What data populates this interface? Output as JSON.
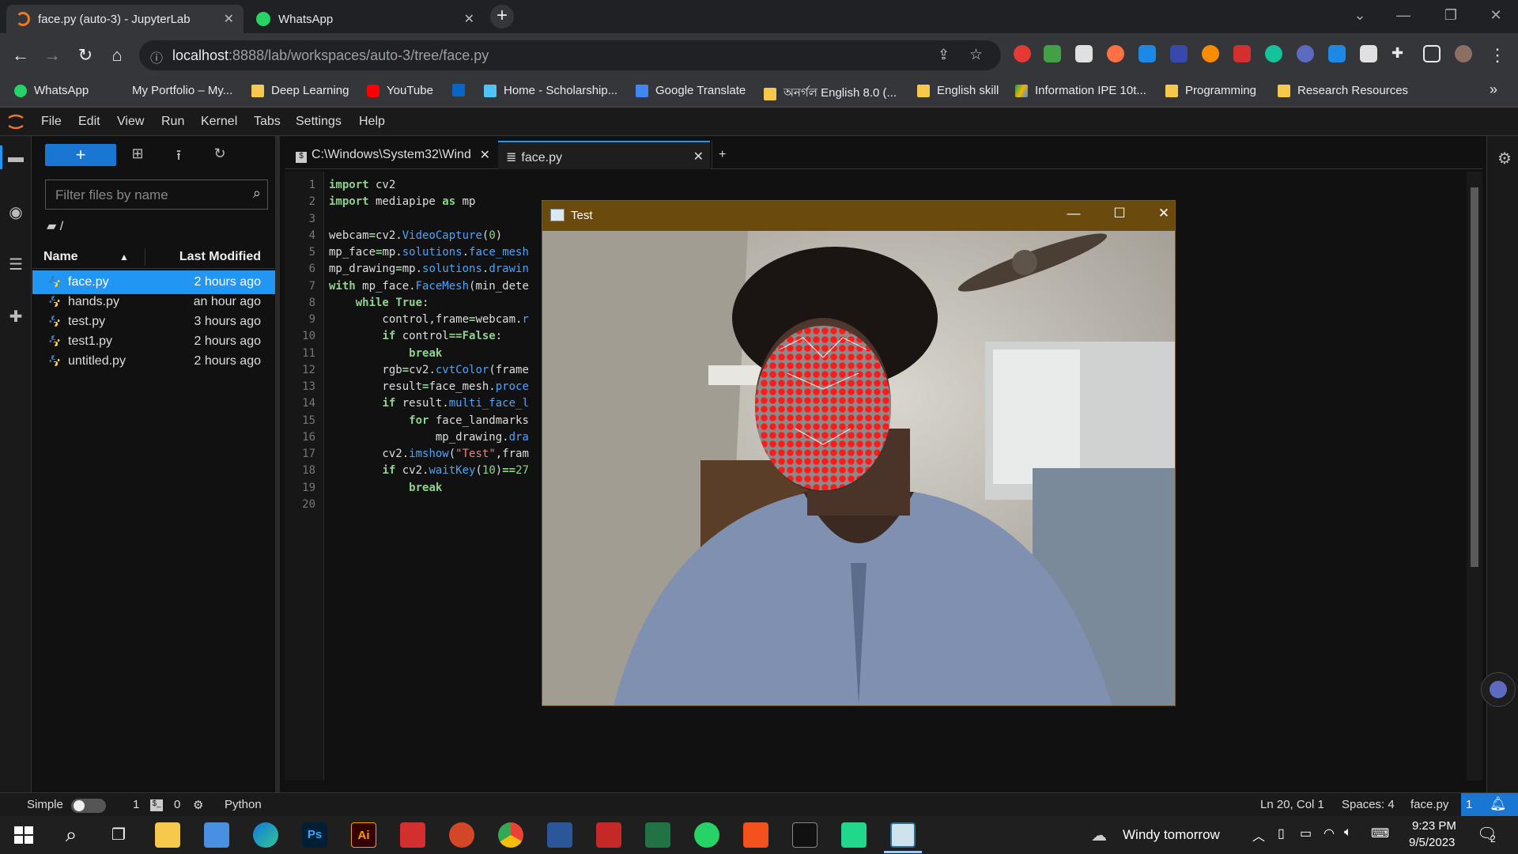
{
  "browser": {
    "tabs": [
      {
        "title": "face.py (auto-3) - JupyterLab",
        "active": true
      },
      {
        "title": "WhatsApp",
        "active": false
      }
    ],
    "url_host": "localhost",
    "url_rest": ":8888/lab/workspaces/auto-3/tree/face.py",
    "bookmarks": [
      "WhatsApp",
      "My Portfolio – My...",
      "Deep Learning",
      "YouTube",
      "Home - Scholarship...",
      "Google Translate",
      "অনর্গল English 8.0 (...",
      "English skill",
      "Information IPE 10t...",
      "Programming",
      "Research Resources"
    ],
    "bookmarks_more": "»"
  },
  "jupyter": {
    "menu": [
      "File",
      "Edit",
      "View",
      "Run",
      "Kernel",
      "Tabs",
      "Settings",
      "Help"
    ],
    "filter_placeholder": "Filter files by name",
    "breadcrumb": "/",
    "columns": {
      "name": "Name",
      "modified": "Last Modified"
    },
    "files": [
      {
        "name": "face.py",
        "modified": "2 hours ago",
        "selected": true
      },
      {
        "name": "hands.py",
        "modified": "an hour ago",
        "selected": false
      },
      {
        "name": "test.py",
        "modified": "3 hours ago",
        "selected": false
      },
      {
        "name": "test1.py",
        "modified": "2 hours ago",
        "selected": false
      },
      {
        "name": "untitled.py",
        "modified": "2 hours ago",
        "selected": false
      }
    ],
    "editor_tabs": [
      {
        "title": "C:\\Windows\\System32\\Wind",
        "active": false
      },
      {
        "title": "face.py",
        "active": true
      }
    ],
    "line_numbers": [
      "1",
      "2",
      "3",
      "4",
      "5",
      "6",
      "7",
      "8",
      "9",
      "10",
      "11",
      "12",
      "13",
      "14",
      "15",
      "16",
      "17",
      "18",
      "19",
      "20"
    ]
  },
  "status": {
    "mode": "Simple",
    "terminals": "1",
    "kernels": "0",
    "language": "Python",
    "cursor": "Ln 20, Col 1",
    "spaces": "Spaces: 4",
    "file": "face.py",
    "notifications": "1"
  },
  "cv_window": {
    "title": "Test"
  },
  "taskbar": {
    "weather": "Windy tomorrow",
    "time": "9:23 PM",
    "date": "9/5/2023",
    "notif_count": "2"
  }
}
